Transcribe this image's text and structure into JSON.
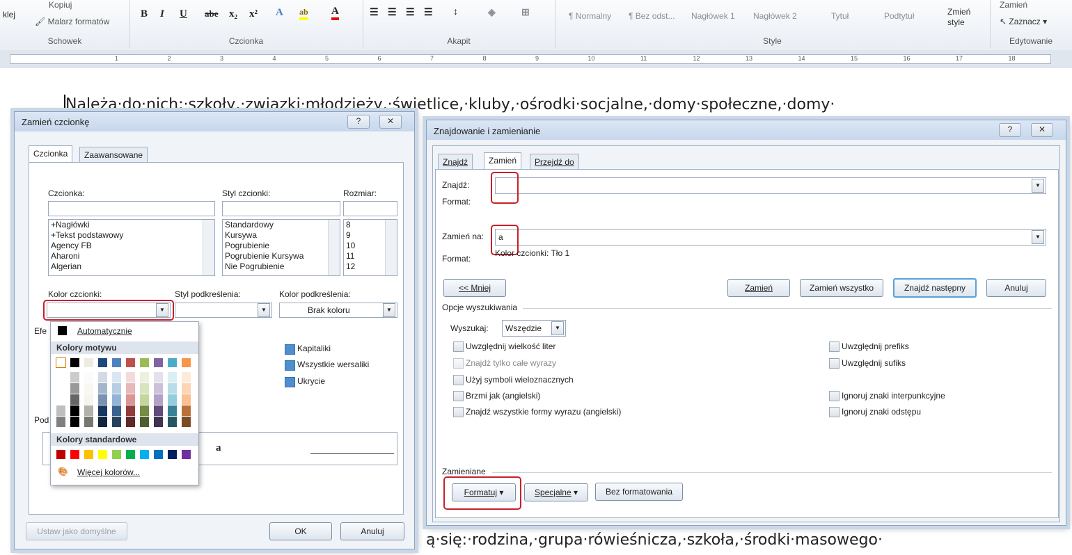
{
  "ribbon": {
    "clipboard": {
      "paste_label": "klej",
      "copy_label": "Kopiuj",
      "format_painter": "Malarz formatów",
      "group": "Schowek"
    },
    "font": {
      "group": "Czcionka",
      "bold": "B",
      "italic": "I",
      "underline": "U",
      "strike": "abe",
      "sub": "x₂",
      "sup": "x²"
    },
    "paragraph": {
      "group": "Akapit"
    },
    "styles": {
      "group": "Style",
      "items": [
        "¶ Normalny",
        "¶ Bez odst...",
        "Nagłówek 1",
        "Nagłówek 2",
        "Tytuł",
        "Podtytuł"
      ],
      "change_styles": "Zmień style"
    },
    "editing": {
      "group": "Edytowanie",
      "select": "Zaznacz",
      "replace": "Zamień"
    }
  },
  "ruler": {
    "numbers": [
      "1",
      "2",
      "3",
      "4",
      "5",
      "6",
      "7",
      "8",
      "9",
      "10",
      "11",
      "12",
      "13",
      "14",
      "15",
      "16",
      "17",
      "18"
    ]
  },
  "document": {
    "line1": "Należą·do·nich:·szkoły,·związki·młodzieży,·świetlice,·kluby,·ośrodki·socjalne,·domy·społeczne,·domy·",
    "line_last": "ą·się:·rodzina,·grupa·rówieśnicza,·szkoła,·środki·masowego·"
  },
  "font_dialog": {
    "title": "Zamień czcionkę",
    "help": "?",
    "close": "✕",
    "tabs": [
      "Czcionka",
      "Zaawansowane"
    ],
    "font_label": "Czcionka:",
    "style_label": "Styl czcionki:",
    "size_label": "Rozmiar:",
    "fonts": [
      "+Nagłówki",
      "+Tekst podstawowy",
      "Agency FB",
      "Aharoni",
      "Algerian"
    ],
    "styles": [
      "Standardowy",
      "Kursywa",
      "Pogrubienie",
      "Pogrubienie Kursywa",
      "Nie Pogrubienie"
    ],
    "sizes": [
      "8",
      "9",
      "10",
      "11",
      "12"
    ],
    "color_label": "Kolor czcionki:",
    "underline_style_label": "Styl podkreślenia:",
    "underline_color_label": "Kolor podkreślenia:",
    "underline_color_value": "Brak koloru",
    "effects_label": "Efe",
    "effects": [
      "Kapitaliki",
      "Wszystkie wersaliki",
      "Ukrycie"
    ],
    "preview_label": "Pod",
    "preview_text": "a",
    "default_button": "Ustaw jako domyślne",
    "ok": "OK",
    "cancel": "Anuluj"
  },
  "color_palette": {
    "automatic": "Automatycznie",
    "theme_header": "Kolory motywu",
    "standard_header": "Kolory standardowe",
    "more": "Więcej kolorów...",
    "theme_colors": [
      "#ffffff",
      "#000000",
      "#eeece1",
      "#1f497d",
      "#4f81bd",
      "#c0504d",
      "#9bbb59",
      "#8064a2",
      "#4bacc6",
      "#f79646"
    ],
    "standard_colors": [
      "#c00000",
      "#ff0000",
      "#ffc000",
      "#ffff00",
      "#92d050",
      "#00b050",
      "#00b0f0",
      "#0070c0",
      "#002060",
      "#7030a0"
    ]
  },
  "find_dialog": {
    "title": "Znajdowanie i zamienianie",
    "help": "?",
    "close": "✕",
    "tabs": [
      "Znajdź",
      "Zamień",
      "Przejdź do"
    ],
    "find_label": "Znajdź:",
    "find_value": "",
    "format_label": "Format:",
    "replace_label": "Zamień na:",
    "replace_value": "a",
    "replace_format_label": "Format:",
    "replace_format_value": "Kolor czcionki: Tło 1",
    "less_button": "<< Mniej",
    "replace_button": "Zamień",
    "replace_all_button": "Zamień wszystko",
    "find_next_button": "Znajdź następny",
    "cancel_button": "Anuluj",
    "options_label": "Opcje wyszukiwania",
    "search_label": "Wyszukaj:",
    "search_value": "Wszędzie",
    "options_left": [
      "Uwzględnij wielkość liter",
      "Znajdź tylko całe wyrazy",
      "Użyj symboli wieloznacznych",
      "Brzmi jak (angielski)",
      "Znajdź wszystkie formy wyrazu (angielski)"
    ],
    "options_right": [
      "Uwzględnij prefiks",
      "Uwzględnij sufiks",
      "Ignoruj znaki interpunkcyjne",
      "Ignoruj znaki odstępu"
    ],
    "replace_section_label": "Zamieniane",
    "format_button": "Formatuj",
    "special_button": "Specjalne",
    "no_format_button": "Bez formatowania"
  }
}
